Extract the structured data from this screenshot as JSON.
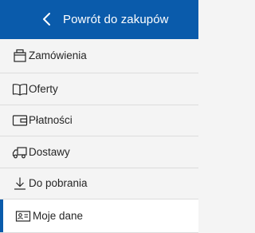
{
  "header": {
    "back_label": "Powrót do zakupów",
    "back_icon": "chevron-left-icon",
    "background_color": "#0a5bab"
  },
  "menu": {
    "items": [
      {
        "label": "Zamówienia",
        "icon": "box-icon",
        "active": false
      },
      {
        "label": "Oferty",
        "icon": "open-book-icon",
        "active": false
      },
      {
        "label": "Płatności",
        "icon": "wallet-icon",
        "active": false
      },
      {
        "label": "Dostawy",
        "icon": "truck-icon",
        "active": false
      },
      {
        "label": "Do pobrania",
        "icon": "download-icon",
        "active": false
      },
      {
        "label": "Moje dane",
        "icon": "id-card-icon",
        "active": true
      }
    ],
    "accent_color": "#0a5bab"
  }
}
